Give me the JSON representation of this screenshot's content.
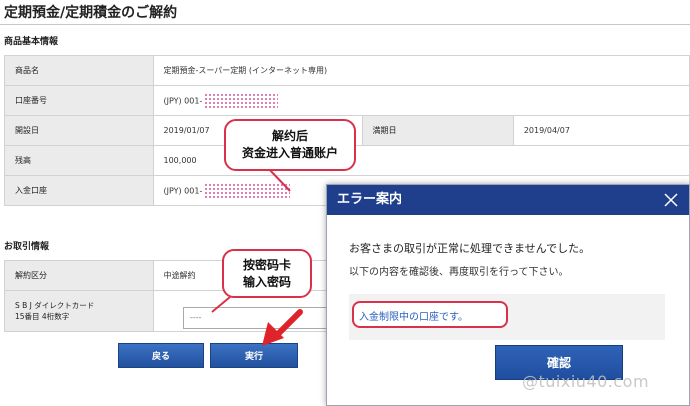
{
  "page": {
    "title": "定期預金/定期積金のご解約"
  },
  "product_section": {
    "title": "商品基本情報",
    "rows": [
      {
        "label": "商品名",
        "value": "定期預金-スーパー定期 (インターネット専用)"
      },
      {
        "label": "口座番号",
        "value": "(JPY)  001-"
      },
      {
        "label": "開設日",
        "value": "2019/01/07",
        "label2": "満期日",
        "value2": "2019/04/07"
      },
      {
        "label": "残高",
        "value": "100,000"
      },
      {
        "label": "入金口座",
        "value": "(JPY)  001-"
      }
    ]
  },
  "transaction_section": {
    "title": "お取引情報",
    "cancel_type_label": "解約区分",
    "cancel_type_value": "中途解約",
    "card_label_line1": "S B J ダイレクトカード",
    "card_label_line2": "15番目 4桁数字",
    "password_value": "----"
  },
  "buttons": {
    "back": "戻る",
    "execute": "実行"
  },
  "callouts": {
    "top": {
      "line1": "解约后",
      "line2": "资金进入普通账户"
    },
    "bottom": {
      "line1": "按密码卡",
      "line2": "输入密码"
    }
  },
  "modal": {
    "title": "エラー案内",
    "message1": "お客さまの取引が正常に処理できませんでした。",
    "message2": "以下の内容を確認後、再度取引を行って下さい。",
    "error": "入金制限中の口座です。",
    "confirm": "確認"
  },
  "watermark": "@tuixiu40.com",
  "colors": {
    "header_blue": "#1f3f8c",
    "button_blue": "#2a5aa8",
    "highlight_red": "#d8324a",
    "link_blue": "#2a5fbf"
  }
}
